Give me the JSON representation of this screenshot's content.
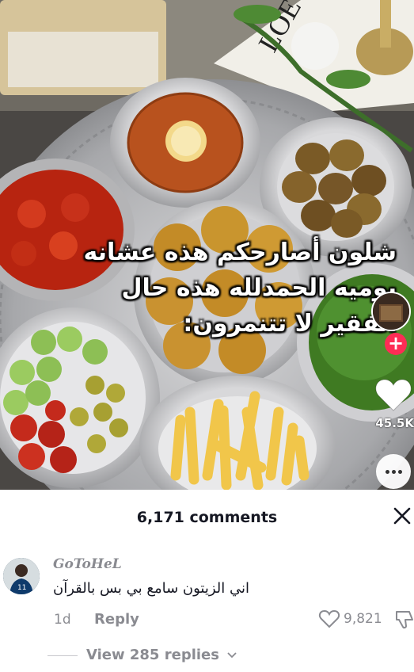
{
  "video": {
    "caption_lines": [
      "شلون أصارحكم هذه عشانه",
      "يوميه الحمدلله هذه حال",
      "الفقير لا تتنمرون:"
    ],
    "book_text": "LOEW",
    "like_count": "45.5K",
    "follow_label": "+"
  },
  "comments": {
    "title": "6,171 comments",
    "items": [
      {
        "username": "GoToHeL",
        "text": "اني الزيتون سامع بي بس بالقرآن",
        "time": "1d",
        "reply_label": "Reply",
        "like_count": "9,821",
        "view_replies_label": "View 285 replies"
      }
    ]
  },
  "icons": {
    "close": "close-icon",
    "like": "heart-icon",
    "more": "more-icon",
    "dislike": "dislike-icon",
    "chevron": "chevron-down-icon"
  },
  "colors": {
    "accent": "#fe2c55",
    "secondary_text": "#8a8b91",
    "primary_text": "#161823"
  }
}
